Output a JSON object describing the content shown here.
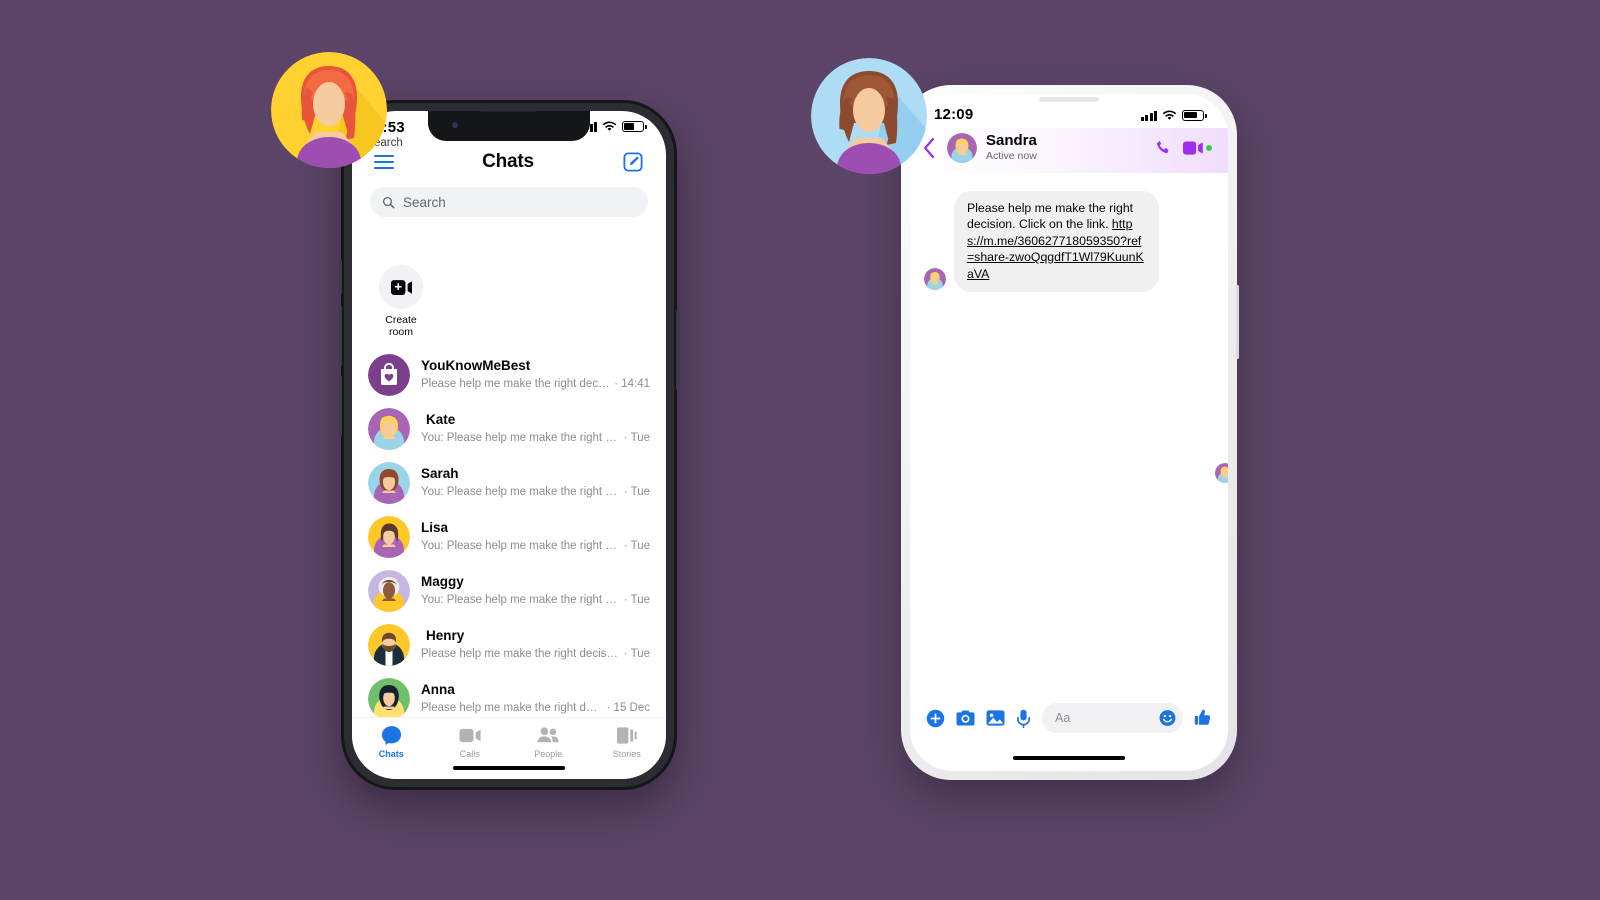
{
  "background_color": "#5B4467",
  "accent_blue": "#1b74e4",
  "accent_purple": "#9d2ff0",
  "left_phone": {
    "frame": "dark",
    "status_bar": {
      "time": "2:53",
      "ghost_text": "earch",
      "signal_icon": "signal-bars-icon",
      "wifi_icon": "wifi-icon",
      "battery_icon": "battery-icon"
    },
    "header": {
      "menu_icon": "hamburger-menu-icon",
      "title": "Chats",
      "compose_icon": "compose-new-message-icon"
    },
    "search": {
      "placeholder": "Search",
      "icon": "search-icon"
    },
    "rooms": {
      "icon": "video-plus-icon",
      "label_line1": "Create",
      "label_line2": "room"
    },
    "chats": [
      {
        "name": "YouKnowMeBest",
        "snippet": "Please help me make the right decision....",
        "time": "· 14:41",
        "avatar": "shop-bag-heart-avatar"
      },
      {
        "name": "Kate",
        "snippet": "You: Please help me make the right decisi...",
        "time": "· Tue",
        "avatar": "woman-blonde-avatar"
      },
      {
        "name": "Sarah",
        "snippet": "You: Please help me make the right decisi...",
        "time": "· Tue",
        "avatar": "woman-brunette-avatar"
      },
      {
        "name": "Lisa",
        "snippet": "You: Please help me make the right decisi...",
        "time": "· Tue",
        "avatar": "woman-bob-avatar"
      },
      {
        "name": "Maggy",
        "snippet": "You: Please help me make the right decisi...",
        "time": "· Tue",
        "avatar": "woman-grey-hair-avatar"
      },
      {
        "name": "Henry",
        "snippet": "Please help me make the right decision. Cl...",
        "time": "· Tue",
        "avatar": "man-beard-avatar"
      },
      {
        "name": "Anna",
        "snippet": "Please help me make the right decision...",
        "time": "· 15 Dec",
        "avatar": "woman-darkhair-avatar"
      }
    ],
    "tabs": [
      {
        "label": "Chats",
        "icon": "chat-bubble-icon",
        "active": true
      },
      {
        "label": "Calls",
        "icon": "video-camera-icon",
        "active": false
      },
      {
        "label": "People",
        "icon": "people-icon",
        "active": false
      },
      {
        "label": "Stories",
        "icon": "stories-icon",
        "active": false
      }
    ]
  },
  "right_phone": {
    "frame": "white",
    "status_bar": {
      "time": "12:09",
      "signal_icon": "signal-bars-icon",
      "wifi_icon": "wifi-icon",
      "battery_icon": "battery-icon"
    },
    "conversation_header": {
      "back_icon": "back-chevron-icon",
      "name": "Sandra",
      "status": "Active now",
      "avatar": "woman-blonde-avatar",
      "call_icon": "phone-call-icon",
      "video_icon": "video-call-icon"
    },
    "message": {
      "text_line1": "Please help me make the right",
      "text_line2": "decision. Click on the link.",
      "link": "https://m.me/360627718059350?ref=share-zwoQqgdfT1Wl79KuunKaVA",
      "sender_avatar": "woman-blonde-avatar"
    },
    "composer": {
      "plus_icon": "plus-circle-icon",
      "camera_icon": "camera-icon",
      "gallery_icon": "gallery-image-icon",
      "mic_icon": "microphone-icon",
      "placeholder": "Aa",
      "emoji_icon": "smiley-emoji-icon",
      "like_icon": "thumbs-up-icon"
    }
  },
  "floating_avatars": [
    {
      "name": "redhead-woman-avatar",
      "bg": "#FFD131"
    },
    {
      "name": "brunette-woman-avatar",
      "bg": "#AEDCF5"
    }
  ]
}
